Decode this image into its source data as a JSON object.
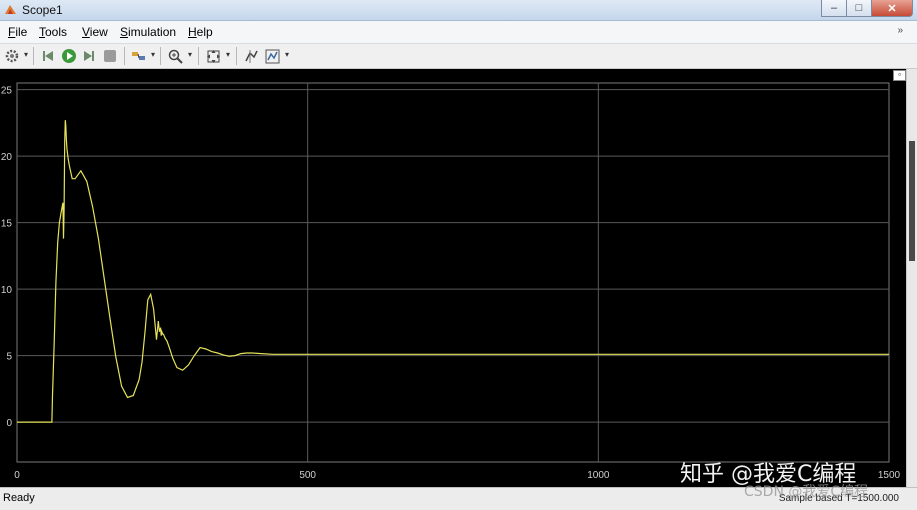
{
  "window": {
    "title": "Scope1",
    "buttons": [
      "minimize",
      "maximize",
      "close"
    ]
  },
  "menu": {
    "items": [
      {
        "label": "File",
        "u": "F",
        "rest": "ile"
      },
      {
        "label": "Tools",
        "u": "T",
        "rest": "ools"
      },
      {
        "label": "View",
        "u": "V",
        "rest": "iew"
      },
      {
        "label": "Simulation",
        "u": "S",
        "rest": "imulation"
      },
      {
        "label": "Help",
        "u": "H",
        "rest": "elp"
      }
    ],
    "overflow_icon": "double-chevron-icon"
  },
  "toolbar": {
    "icons": [
      "gear-icon",
      "step-back-icon",
      "run-icon",
      "step-forward-icon",
      "stop-icon",
      "highlight-icon",
      "zoom-in-icon",
      "fit-to-view-icon",
      "cursor-measure-icon",
      "signal-props-icon"
    ]
  },
  "status": {
    "text": "Ready",
    "sample_based": "Sample based  T=1500.000"
  },
  "watermark": {
    "main": "知乎 @我爱C编程",
    "secondary": "CSDN @我爱C编程"
  },
  "colors": {
    "plot_bg": "#000000",
    "grid": "#5a5a5a",
    "trace": "#e6e35a",
    "axis_text": "#d0d0d0"
  },
  "chart_data": {
    "type": "line",
    "title": "",
    "xlabel": "",
    "ylabel": "",
    "xlim": [
      0,
      1500
    ],
    "ylim": [
      -3,
      25.5
    ],
    "xticks": [
      0,
      500,
      1000,
      1500
    ],
    "xtick_labels": [
      "0",
      "500",
      "1000",
      "1500"
    ],
    "yticks": [
      0,
      5,
      10,
      15,
      20,
      25
    ],
    "ytick_labels": [
      "0",
      "5",
      "10",
      "15",
      "20",
      "25"
    ],
    "grid": true,
    "series": [
      {
        "x": [
          0,
          60,
          61,
          64,
          67,
          70,
          73,
          76,
          79,
          80,
          81,
          82,
          83,
          84,
          85,
          86,
          88,
          90,
          95,
          100,
          110,
          120,
          130,
          140,
          150,
          160,
          170,
          180,
          190,
          200,
          210,
          215,
          220,
          225,
          230,
          235,
          240,
          243,
          245,
          247,
          248,
          249,
          250,
          251,
          252,
          253,
          255,
          258,
          262,
          268,
          275,
          285,
          295,
          305,
          315,
          325,
          335,
          345,
          355,
          365,
          375,
          385,
          395,
          405,
          420,
          440,
          470,
          500,
          700,
          1000,
          1500
        ],
        "y": [
          0,
          0,
          2.0,
          6.0,
          10.5,
          13.5,
          15.0,
          15.8,
          16.5,
          13.8,
          16.0,
          21.0,
          22.7,
          22.3,
          21.2,
          20.5,
          19.8,
          19.3,
          18.3,
          18.3,
          18.9,
          18.1,
          16.2,
          13.8,
          10.8,
          7.8,
          4.9,
          2.7,
          1.85,
          2.0,
          3.2,
          4.5,
          6.7,
          9.2,
          9.6,
          8.5,
          6.2,
          7.6,
          6.8,
          7.1,
          6.5,
          6.8,
          6.7,
          6.6,
          6.6,
          6.5,
          6.3,
          6.1,
          5.6,
          4.8,
          4.1,
          3.9,
          4.3,
          5.0,
          5.6,
          5.5,
          5.3,
          5.2,
          5.05,
          4.95,
          5.0,
          5.15,
          5.2,
          5.2,
          5.15,
          5.1,
          5.1,
          5.1,
          5.1,
          5.1,
          5.1
        ]
      }
    ]
  }
}
